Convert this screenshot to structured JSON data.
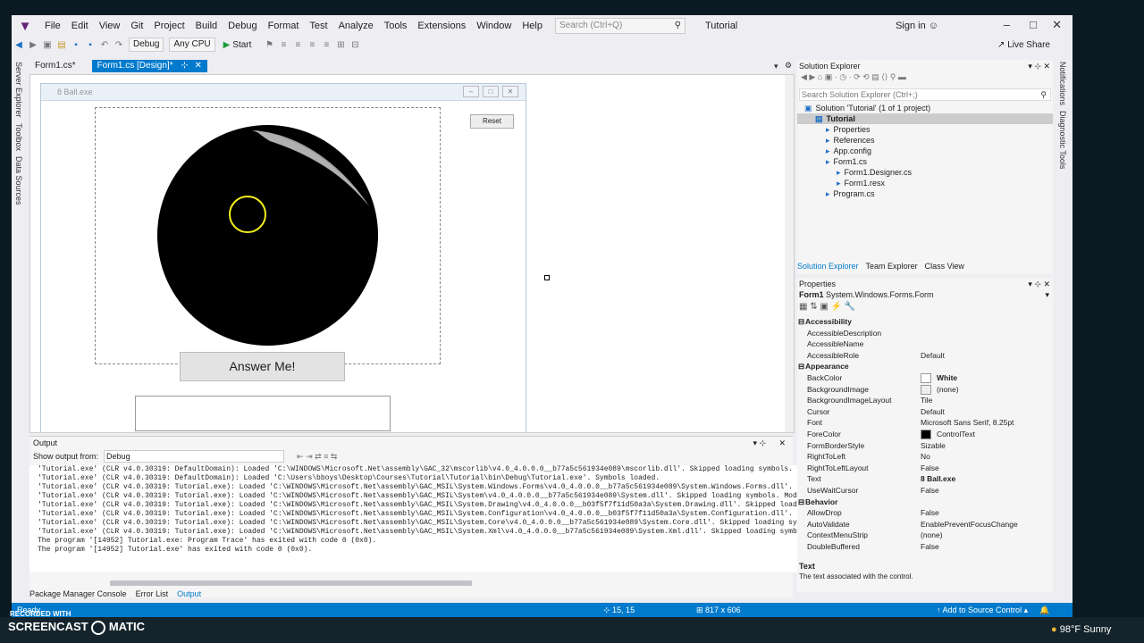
{
  "menu": [
    "File",
    "Edit",
    "View",
    "Git",
    "Project",
    "Build",
    "Debug",
    "Format",
    "Test",
    "Analyze",
    "Tools",
    "Extensions",
    "Window",
    "Help"
  ],
  "search_placeholder": "Search (Ctrl+Q)",
  "window_title": "Tutorial",
  "sign_in": "Sign in",
  "live_share": "Live Share",
  "toolbar": {
    "config": "Debug",
    "platform": "Any CPU",
    "start": "Start"
  },
  "side_tabs": [
    "Server Explorer",
    "Toolbox",
    "Data Sources"
  ],
  "doc_tabs": [
    "Form1.cs*",
    "Form1.cs [Design]*"
  ],
  "form": {
    "title": "8 Ball.exe",
    "reset_label": "Reset",
    "answer_label": "Answer Me!"
  },
  "output": {
    "title": "Output",
    "show_from_label": "Show output from:",
    "show_from_value": "Debug",
    "lines": [
      "'Tutorial.exe' (CLR v4.0.30319: DefaultDomain): Loaded 'C:\\WINDOWS\\Microsoft.Net\\assembly\\GAC_32\\mscorlib\\v4.0_4.0.0.0__b77a5c561934e089\\mscorlib.dll'. Skipped loading symbols. M",
      "'Tutorial.exe' (CLR v4.0.30319: DefaultDomain): Loaded 'C:\\Users\\bboys\\Desktop\\Courses\\Tutorial\\Tutorial\\bin\\Debug\\Tutorial.exe'. Symbols loaded.",
      "'Tutorial.exe' (CLR v4.0.30319: Tutorial.exe): Loaded 'C:\\WINDOWS\\Microsoft.Net\\assembly\\GAC_MSIL\\System.Windows.Forms\\v4.0_4.0.0.0__b77a5c561934e089\\System.Windows.Forms.dll'. S",
      "'Tutorial.exe' (CLR v4.0.30319: Tutorial.exe): Loaded 'C:\\WINDOWS\\Microsoft.Net\\assembly\\GAC_MSIL\\System\\v4.0_4.0.0.0__b77a5c561934e089\\System.dll'. Skipped loading symbols. Modu",
      "'Tutorial.exe' (CLR v4.0.30319: Tutorial.exe): Loaded 'C:\\WINDOWS\\Microsoft.Net\\assembly\\GAC_MSIL\\System.Drawing\\v4.0_4.0.0.0__b03f5f7f11d50a3a\\System.Drawing.dll'. Skipped loadi",
      "'Tutorial.exe' (CLR v4.0.30319: Tutorial.exe): Loaded 'C:\\WINDOWS\\Microsoft.Net\\assembly\\GAC_MSIL\\System.Configuration\\v4.0_4.0.0.0__b03f5f7f11d50a3a\\System.Configuration.dll'. S",
      "'Tutorial.exe' (CLR v4.0.30319: Tutorial.exe): Loaded 'C:\\WINDOWS\\Microsoft.Net\\assembly\\GAC_MSIL\\System.Core\\v4.0_4.0.0.0__b77a5c561934e089\\System.Core.dll'. Skipped loading sym",
      "'Tutorial.exe' (CLR v4.0.30319: Tutorial.exe): Loaded 'C:\\WINDOWS\\Microsoft.Net\\assembly\\GAC_MSIL\\System.Xml\\v4.0_4.0.0.0__b77a5c561934e089\\System.Xml.dll'. Skipped loading symbo",
      "The program '[14952] Tutorial.exe: Program Trace' has exited with code 0 (0x0).",
      "The program '[14952] Tutorial.exe' has exited with code 0 (0x0)."
    ]
  },
  "bottom_tabs": [
    "Package Manager Console",
    "Error List",
    "Output"
  ],
  "solution_explorer": {
    "title": "Solution Explorer",
    "search_placeholder": "Search Solution Explorer (Ctrl+;)",
    "items": [
      {
        "label": "Solution 'Tutorial' (1 of 1 project)",
        "indent": 0
      },
      {
        "label": "Tutorial",
        "indent": 1,
        "bold": true
      },
      {
        "label": "Properties",
        "indent": 2
      },
      {
        "label": "References",
        "indent": 2
      },
      {
        "label": "App.config",
        "indent": 2
      },
      {
        "label": "Form1.cs",
        "indent": 2
      },
      {
        "label": "Form1.Designer.cs",
        "indent": 3
      },
      {
        "label": "Form1.resx",
        "indent": 3
      },
      {
        "label": "Program.cs",
        "indent": 2
      }
    ],
    "tabs": [
      "Solution Explorer",
      "Team Explorer",
      "Class View"
    ]
  },
  "properties": {
    "title": "Properties",
    "object": "Form1",
    "object_type": "System.Windows.Forms.Form",
    "rows": [
      {
        "cat": true,
        "name": "Accessibility"
      },
      {
        "name": "AccessibleDescription",
        "value": ""
      },
      {
        "name": "AccessibleName",
        "value": ""
      },
      {
        "name": "AccessibleRole",
        "value": "Default"
      },
      {
        "cat": true,
        "name": "Appearance"
      },
      {
        "name": "BackColor",
        "value": "White",
        "swatch": "#ffffff",
        "bold": true
      },
      {
        "name": "BackgroundImage",
        "value": "(none)",
        "swatch": "#eeeeee"
      },
      {
        "name": "BackgroundImageLayout",
        "value": "Tile"
      },
      {
        "name": "Cursor",
        "value": "Default"
      },
      {
        "name": "Font",
        "value": "Microsoft Sans Serif, 8.25pt"
      },
      {
        "name": "ForeColor",
        "value": "ControlText",
        "swatch": "#000000"
      },
      {
        "name": "FormBorderStyle",
        "value": "Sizable"
      },
      {
        "name": "RightToLeft",
        "value": "No"
      },
      {
        "name": "RightToLeftLayout",
        "value": "False"
      },
      {
        "name": "Text",
        "value": "8 Ball.exe",
        "bold": true
      },
      {
        "name": "UseWaitCursor",
        "value": "False"
      },
      {
        "cat": true,
        "name": "Behavior"
      },
      {
        "name": "AllowDrop",
        "value": "False"
      },
      {
        "name": "AutoValidate",
        "value": "EnablePreventFocusChange"
      },
      {
        "name": "ContextMenuStrip",
        "value": "(none)"
      },
      {
        "name": "DoubleBuffered",
        "value": "False"
      }
    ],
    "desc_title": "Text",
    "desc_text": "The text associated with the control."
  },
  "notifications_strip": [
    "Notifications",
    "Diagnostic Tools"
  ],
  "status": {
    "ready": "Ready",
    "position": "15, 15",
    "size": "817 x 606",
    "source_control": "Add to Source Control"
  },
  "taskbar": {
    "recorded_with": "RECORDED WITH",
    "brand": "SCREENCAST",
    "brand2": "MATIC",
    "weather": "98°F  Sunny"
  }
}
